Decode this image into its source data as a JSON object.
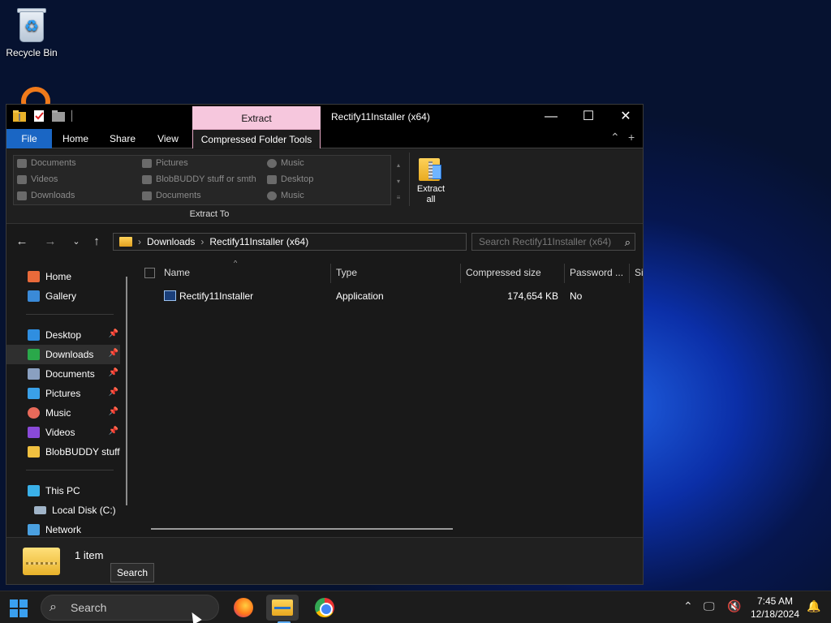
{
  "desktop": {
    "recycle_bin_label": "Recycle Bin"
  },
  "window": {
    "title": "Rectify11Installer (x64)",
    "context_tab_group": "Extract",
    "ribbon_tabs": [
      "File",
      "Home",
      "Share",
      "View",
      "Compressed Folder Tools"
    ],
    "controls": {
      "minimize": "—",
      "maximize": "☐",
      "close": "✕"
    },
    "extract_to": {
      "items": [
        [
          "Documents",
          "Pictures",
          "Music"
        ],
        [
          "Videos",
          "BlobBUDDY stuff or smth",
          "Desktop"
        ],
        [
          "Downloads",
          "Documents",
          "Music"
        ]
      ],
      "group_label": "Extract To"
    },
    "extract_all_label": "Extract all",
    "address": {
      "breadcrumbs": [
        "Downloads",
        "Rectify11Installer (x64)"
      ]
    },
    "search": {
      "placeholder": "Search Rectify11Installer (x64)"
    },
    "nav": {
      "quick": [
        "Home",
        "Gallery"
      ],
      "pinned": [
        "Desktop",
        "Downloads",
        "Documents",
        "Pictures",
        "Music",
        "Videos",
        "BlobBUDDY stuff"
      ],
      "selected": "Downloads",
      "this_pc": "This PC",
      "local_disk": "Local Disk (C:)",
      "network": "Network"
    },
    "columns": [
      "Name",
      "Type",
      "Compressed size",
      "Password ...",
      "Si"
    ],
    "files": [
      {
        "name": "Rectify11Installer",
        "type": "Application",
        "compressed_size": "174,654 KB",
        "password": "No"
      }
    ],
    "status": {
      "item_count": "1 item"
    }
  },
  "tooltip": "Search",
  "taskbar": {
    "search_label": "Search",
    "apps": [
      "firefox",
      "file-explorer",
      "chrome"
    ],
    "clock": {
      "time": "7:45 AM",
      "date": "12/18/2024"
    }
  }
}
